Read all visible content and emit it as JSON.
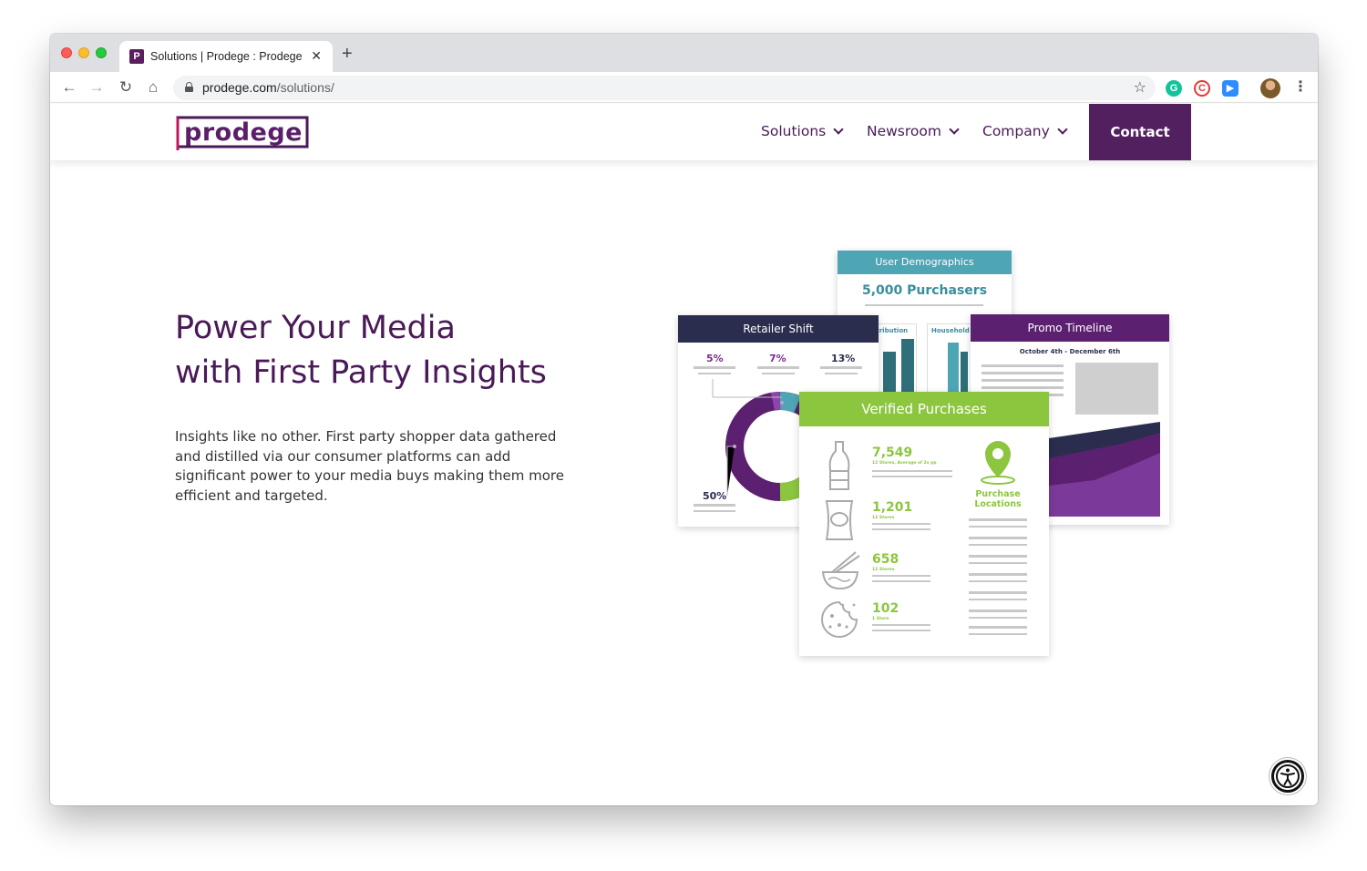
{
  "browser": {
    "tab_title": "Solutions | Prodege : Prodege",
    "tab_favicon": "P",
    "url_host": "prodege.com",
    "url_path": "/solutions/"
  },
  "nav": {
    "items": [
      {
        "label": "Solutions"
      },
      {
        "label": "Newsroom"
      },
      {
        "label": "Company"
      }
    ],
    "contact_label": "Contact"
  },
  "hero": {
    "headline_line1": "Power Your Media",
    "headline_line2": "with First Party Insights",
    "body": "Insights like no other. First party shopper data gathered and distilled via our consumer platforms can add significant power to your media buys making them more efficient and targeted."
  },
  "infographic": {
    "user_demographics": {
      "title": "User Demographics",
      "value": "5,000 Purchasers",
      "col1": "Distribution",
      "col2": "Household"
    },
    "retailer_shift": {
      "title": "Retailer Shift",
      "pct1": "5%",
      "pct2": "7%",
      "pct3": "13%",
      "pct4": "50%"
    },
    "promo_timeline": {
      "title": "Promo Timeline",
      "dates": "October 4th - December 6th"
    },
    "verified_purchases": {
      "title": "Verified Purchases",
      "rows": [
        {
          "value": "7,549",
          "sub": "12 Stores, Average of 2x pp"
        },
        {
          "value": "1,201",
          "sub": "12 Stores"
        },
        {
          "value": "658",
          "sub": "12 Stores"
        },
        {
          "value": "102",
          "sub": "1 Store"
        }
      ],
      "location_label_1": "Purchase",
      "location_label_2": "Locations"
    }
  },
  "colors": {
    "brand_purple": "#4a1a58",
    "contact_bg": "#53205f",
    "teal": "#4ea6b5",
    "green": "#8cc63f",
    "navy": "#2b2d4f"
  }
}
